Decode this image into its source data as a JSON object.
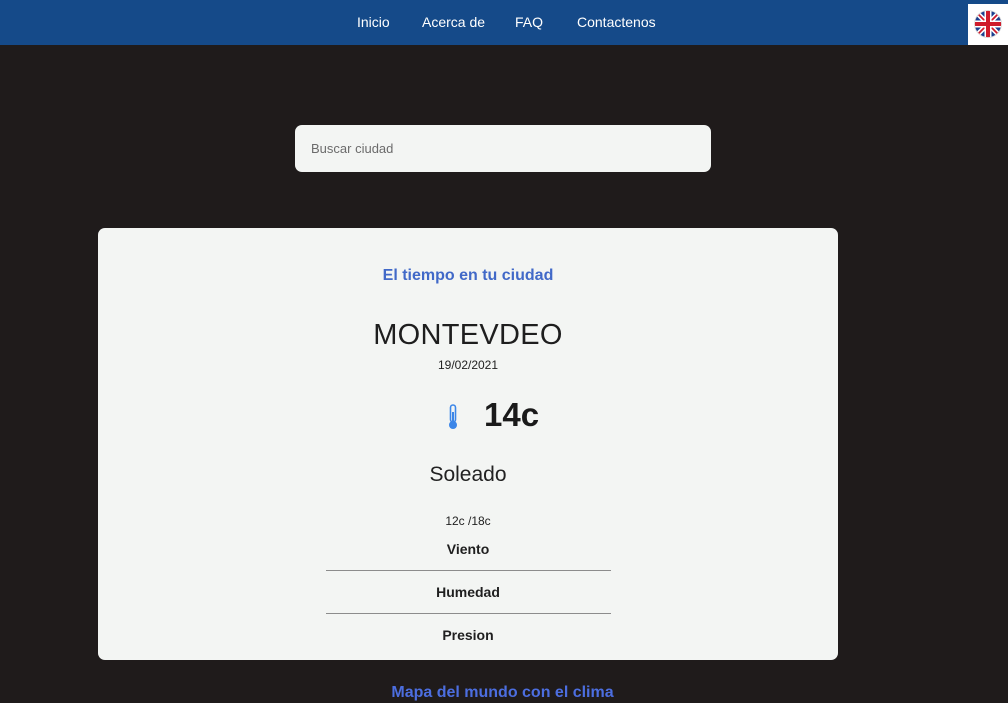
{
  "nav": {
    "items": [
      {
        "label": "Inicio"
      },
      {
        "label": "Acerca de"
      },
      {
        "label": "FAQ"
      },
      {
        "label": "Contactenos"
      }
    ],
    "language_flag_icon": "uk-flag-icon"
  },
  "search": {
    "placeholder": "Buscar ciudad",
    "value": ""
  },
  "weather": {
    "title": "El tiempo en tu ciudad",
    "city": "MONTEVDEO",
    "date": "19/02/2021",
    "temperature": "14c",
    "temperature_icon": "thermometer-icon",
    "condition": "Soleado",
    "min_max": "12c /18c",
    "details": [
      {
        "label": "Viento"
      },
      {
        "label": "Humedad"
      },
      {
        "label": "Presion"
      }
    ]
  },
  "footer": {
    "map_link": "Mapa del mundo con el clima"
  },
  "colors": {
    "navbar": "#154a89",
    "background": "#1f1b1b",
    "card": "#f3f5f3",
    "accent_title": "#4169c8",
    "map_link": "#4c6ee0"
  }
}
